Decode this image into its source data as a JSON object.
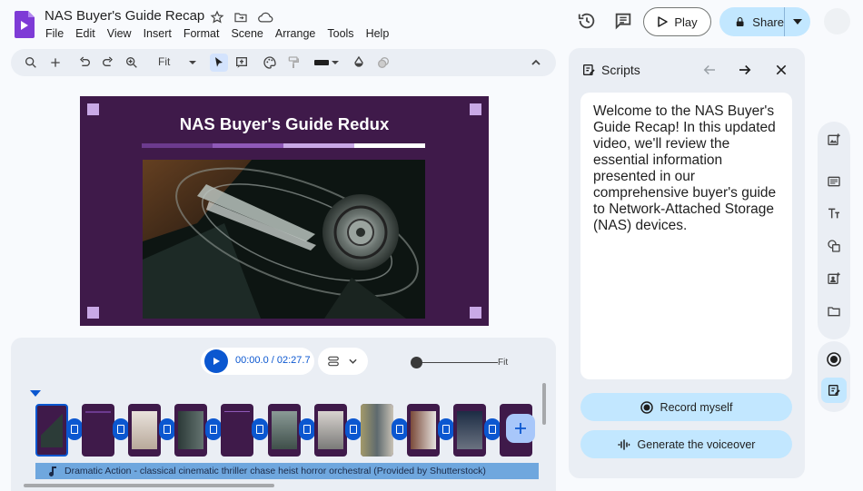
{
  "app": {
    "title": "NAS Buyer's Guide Recap",
    "menu": [
      "File",
      "Edit",
      "View",
      "Insert",
      "Format",
      "Scene",
      "Arrange",
      "Tools",
      "Help"
    ],
    "play_label": "Play",
    "share_label": "Share"
  },
  "toolbar": {
    "zoom_value": "Fit"
  },
  "slide": {
    "title": "NAS Buyer's Guide Redux"
  },
  "timeline": {
    "time_current": "00:00.0",
    "time_total": "02:27.7",
    "time_separator": " / ",
    "zoom_label": "Fit",
    "audio_track": "Dramatic Action - classical cinematic thriller chase heist horror orchestral (Provided by Shutterstock)"
  },
  "scripts": {
    "title": "Scripts",
    "text": "Welcome to the NAS Buyer's Guide Recap! In this updated video, we'll review the essential information presented in our comprehensive buyer's guide to Network-Attached Storage (NAS) devices.",
    "record_label": "Record myself",
    "voiceover_label": "Generate the voiceover"
  },
  "colors": {
    "accent": "#0b57d0",
    "share_bg": "#c2e7ff",
    "slide_bg": "#3f1a4a",
    "slide_corner": "#c9a9e6"
  }
}
